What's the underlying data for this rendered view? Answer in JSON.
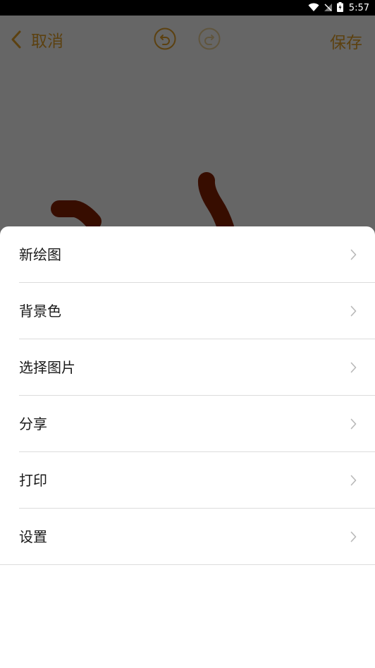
{
  "status_bar": {
    "time": "5:57",
    "icons": [
      "wifi-icon",
      "no-signal-icon",
      "battery-charging-icon"
    ]
  },
  "toolbar": {
    "cancel_label": "取消",
    "save_label": "保存",
    "icons": [
      "chevron-left-icon",
      "undo-icon",
      "redo-icon"
    ],
    "accent_color": "#e6a22a"
  },
  "canvas": {
    "stroke_color": "#8b2200"
  },
  "menu": {
    "items": [
      {
        "label": "新绘图"
      },
      {
        "label": "背景色"
      },
      {
        "label": "选择图片"
      },
      {
        "label": "分享"
      },
      {
        "label": "打印"
      },
      {
        "label": "设置"
      }
    ]
  }
}
